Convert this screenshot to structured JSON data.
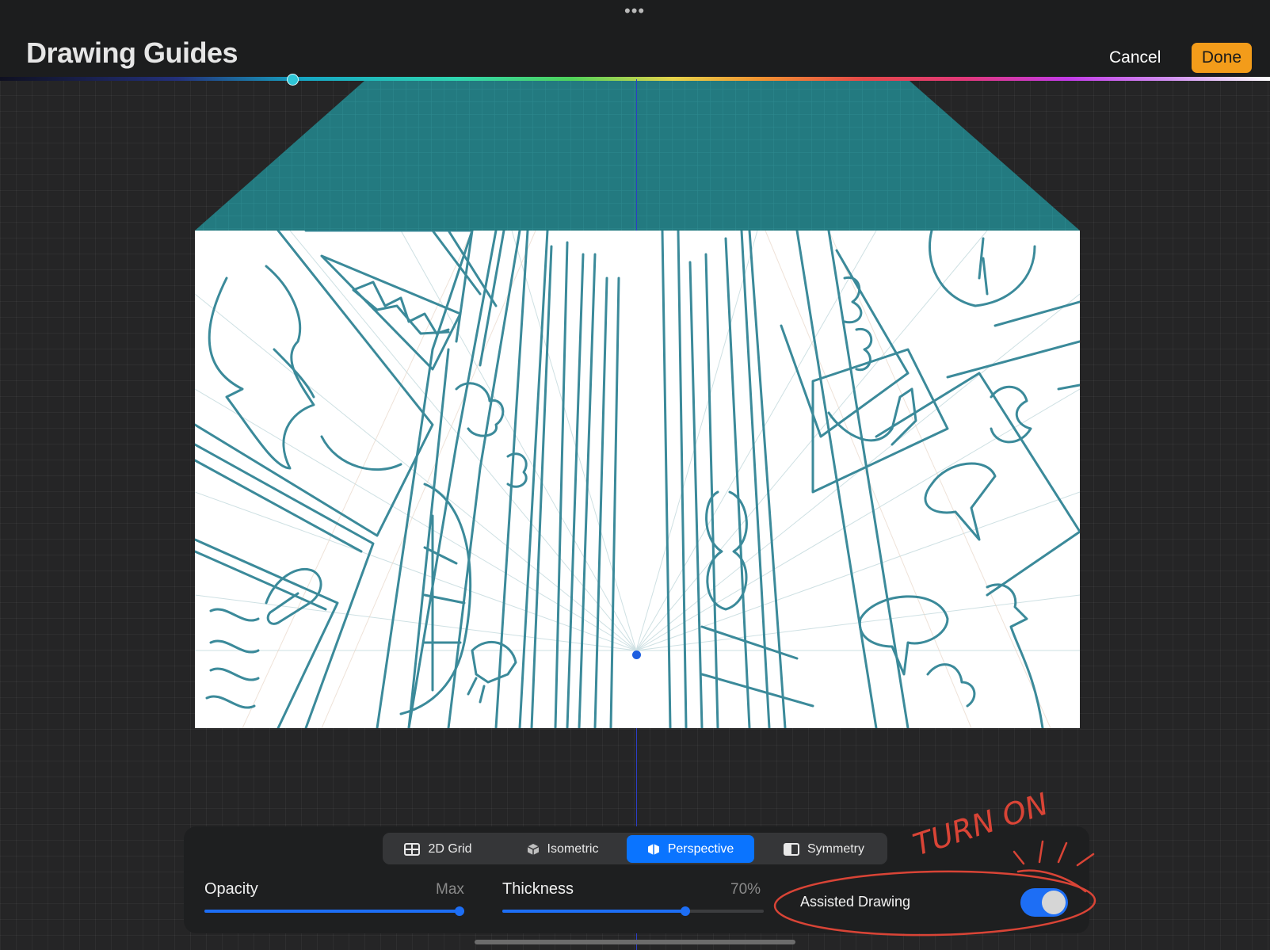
{
  "header": {
    "title": "Drawing Guides",
    "cancel_label": "Cancel",
    "done_label": "Done",
    "grabber_icon": "ellipsis-grabber-icon"
  },
  "color_slider": {
    "handle_position_fraction": 0.23,
    "handle_color": "#2fc6d6"
  },
  "guide_modes": {
    "selected": "Perspective",
    "options": [
      {
        "label": "2D Grid",
        "icon": "grid-icon"
      },
      {
        "label": "Isometric",
        "icon": "cube-icon"
      },
      {
        "label": "Perspective",
        "icon": "perspective-icon"
      },
      {
        "label": "Symmetry",
        "icon": "symmetry-icon"
      }
    ]
  },
  "sliders": {
    "opacity": {
      "label": "Opacity",
      "value_text": "Max",
      "fraction": 1.0
    },
    "thickness": {
      "label": "Thickness",
      "value_text": "70%",
      "fraction": 0.7
    }
  },
  "assisted_drawing": {
    "label": "Assisted Drawing",
    "enabled": true
  },
  "annotation": {
    "text": "TURN ON",
    "color": "#d94436"
  },
  "colors": {
    "accent": "#0a74ff",
    "done_button": "#f39c1a",
    "guide_teal": "#237a80",
    "sketch_stroke": "#3b8a9a"
  }
}
